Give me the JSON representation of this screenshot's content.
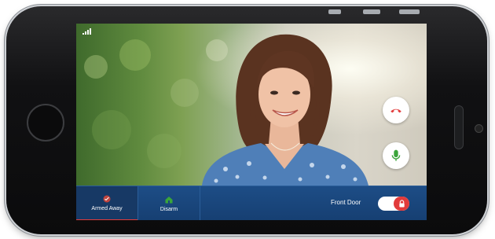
{
  "status_bar": {
    "signal_icon": "cell-signal-icon"
  },
  "call_controls": {
    "hangup_icon": "phone-hangup-icon",
    "hangup_color": "#e23b3b",
    "mic_icon": "microphone-icon",
    "mic_color": "#3aa53a"
  },
  "bottom_bar": {
    "armed_away": {
      "label": "Armed Away",
      "icon": "armed-away-icon",
      "active": true
    },
    "disarm": {
      "label": "Disarm",
      "icon": "disarm-house-icon"
    },
    "front_door": {
      "label": "Front Door",
      "lock_icon": "lock-icon",
      "locked": true
    }
  },
  "colors": {
    "bar_background": "#1a4680",
    "active_indicator": "#e03a3a",
    "toggle_on": "#e23b3b"
  }
}
